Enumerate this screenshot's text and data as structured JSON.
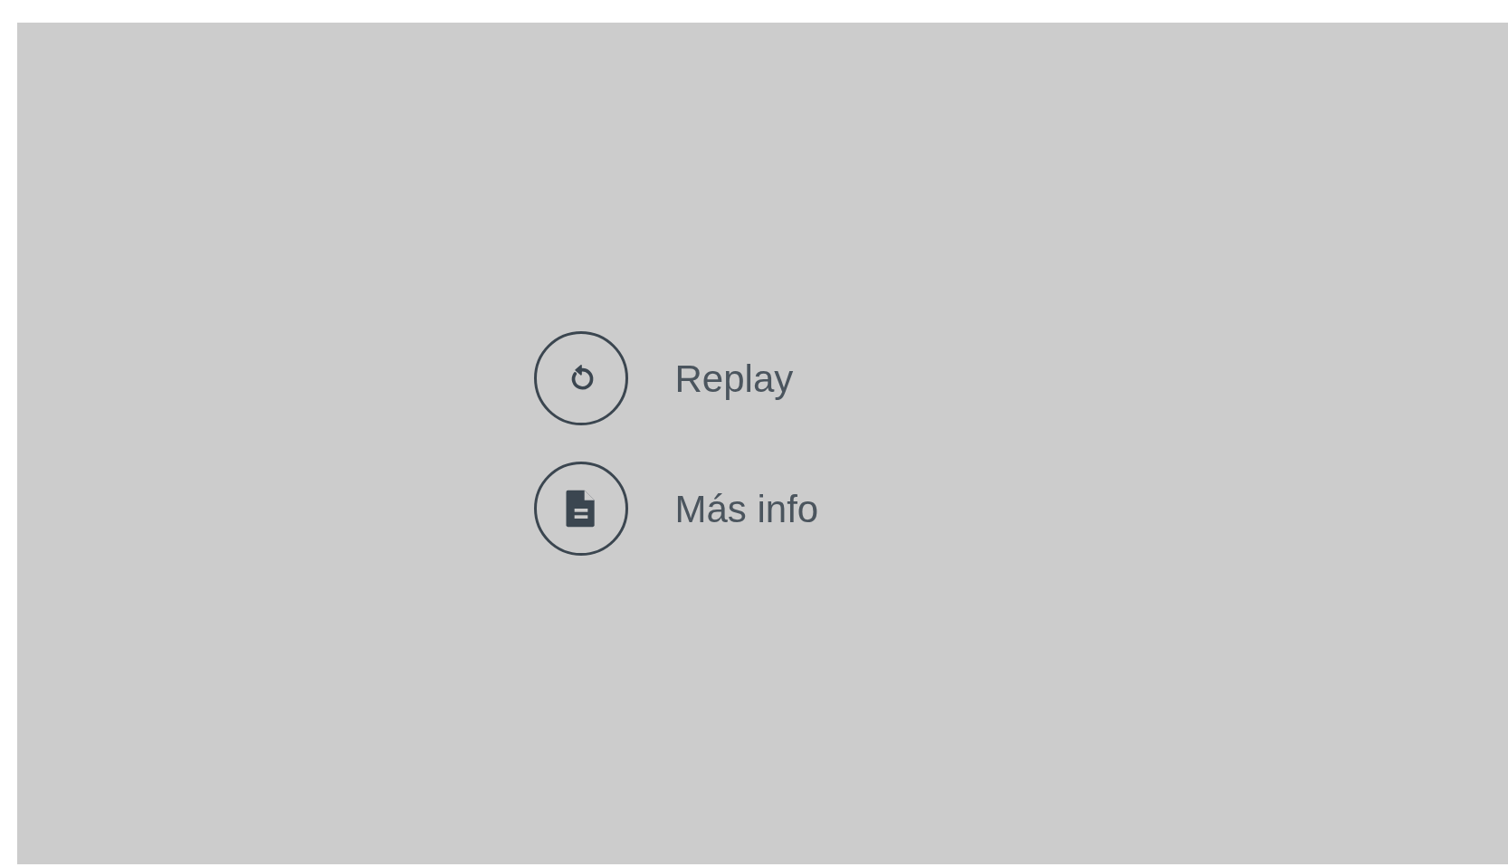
{
  "ad_panel": {
    "actions": [
      {
        "kind": "replay",
        "label": "Replay"
      },
      {
        "kind": "info",
        "label": "Más info"
      }
    ]
  }
}
